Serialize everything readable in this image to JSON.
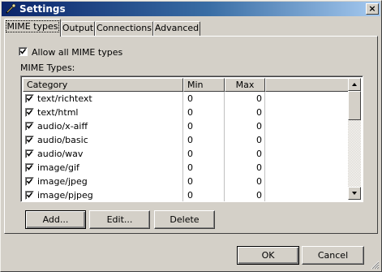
{
  "window": {
    "title": "Settings",
    "close_label": "×"
  },
  "tabs": [
    {
      "label": "MIME types",
      "active": true
    },
    {
      "label": "Output",
      "active": false
    },
    {
      "label": "Connections",
      "active": false
    },
    {
      "label": "Advanced",
      "active": false
    }
  ],
  "allow_all": {
    "label": "Allow all MIME types",
    "checked": true
  },
  "list": {
    "label": "MIME Types:",
    "columns": [
      "Category",
      "Min",
      "Max"
    ],
    "rows": [
      {
        "category": "text/richtext",
        "min": "0",
        "max": "0",
        "checked": true
      },
      {
        "category": "text/html",
        "min": "0",
        "max": "0",
        "checked": true
      },
      {
        "category": "audio/x-aiff",
        "min": "0",
        "max": "0",
        "checked": true
      },
      {
        "category": "audio/basic",
        "min": "0",
        "max": "0",
        "checked": true
      },
      {
        "category": "audio/wav",
        "min": "0",
        "max": "0",
        "checked": true
      },
      {
        "category": "image/gif",
        "min": "0",
        "max": "0",
        "checked": true
      },
      {
        "category": "image/jpeg",
        "min": "0",
        "max": "0",
        "checked": true
      },
      {
        "category": "image/pjpeg",
        "min": "0",
        "max": "0",
        "checked": true
      }
    ]
  },
  "buttons": {
    "add": "Add...",
    "edit": "Edit...",
    "delete": "Delete",
    "ok": "OK",
    "cancel": "Cancel"
  },
  "colors": {
    "titlebar_start": "#0a246a",
    "titlebar_end": "#a6caf0",
    "face": "#d4d0c8"
  }
}
